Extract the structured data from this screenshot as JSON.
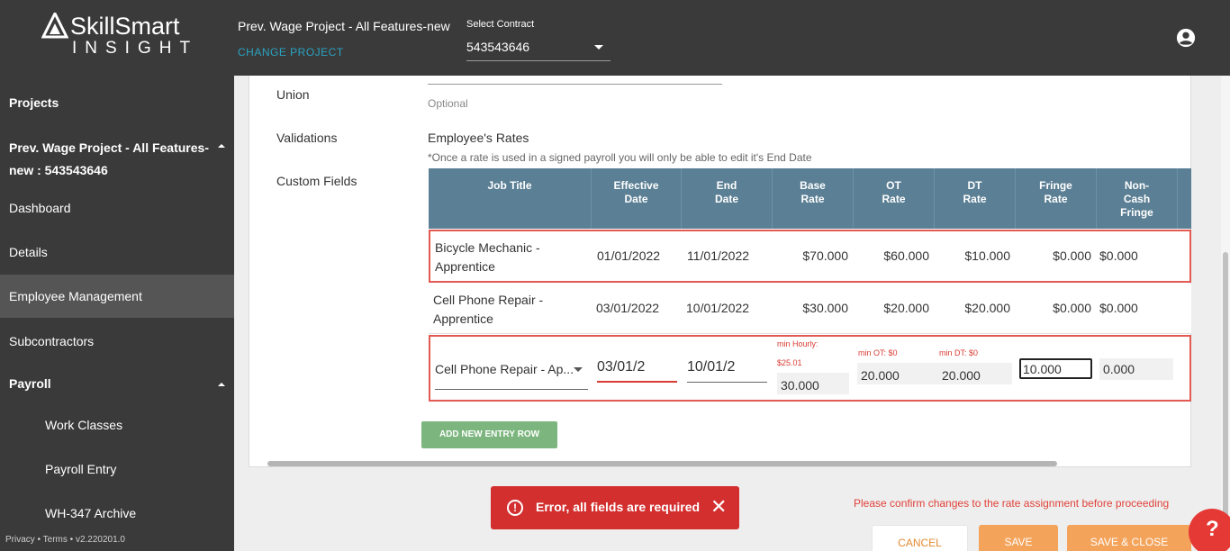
{
  "header": {
    "logo_main": "SkillSmart",
    "logo_sub": "INSIGHT",
    "project_title": "Prev. Wage Project - All Features-new",
    "change_project": "CHANGE PROJECT",
    "contract_label": "Select Contract",
    "contract_value": "543543646",
    "account_icon": "account-circle-icon"
  },
  "sidebar": {
    "projects": "Projects",
    "current_project_line1": "Prev. Wage Project - All Features-",
    "current_project_line2": "new : 543543646",
    "items": [
      "Dashboard",
      "Details",
      "Employee Management",
      "Subcontractors"
    ],
    "payroll": "Payroll",
    "payroll_items": [
      "Work Classes",
      "Payroll Entry",
      "WH-347 Archive"
    ],
    "footer": "Privacy • Terms • v2.220201.0",
    "active_item": "Employee Management"
  },
  "form": {
    "union_label": "Union",
    "union_hint": "Optional",
    "validations_label": "Validations",
    "custom_fields_label": "Custom Fields",
    "rates_title": "Employee's Rates",
    "rates_note": "*Once a rate is used in a signed payroll you will only be able to edit it's End Date"
  },
  "table": {
    "headers": {
      "job_title": "Job Title",
      "effective_date_1": "Effective",
      "effective_date_2": "Date",
      "end_date_1": "End",
      "end_date_2": "Date",
      "base_rate_1": "Base",
      "base_rate_2": "Rate",
      "ot_rate_1": "OT",
      "ot_rate_2": "Rate",
      "dt_rate_1": "DT",
      "dt_rate_2": "Rate",
      "fringe_rate_1": "Fringe",
      "fringe_rate_2": "Rate",
      "non_cash_1": "Non-",
      "non_cash_2": "Cash",
      "non_cash_3": "Fringe"
    },
    "rows": [
      {
        "job_line1": "Bicycle Mechanic -",
        "job_line2": "Apprentice",
        "effective": "01/01/2022",
        "end": "11/01/2022",
        "base": "$70.000",
        "ot": "$60.000",
        "dt": "$10.000",
        "fringe": "$0.000",
        "non_cash": "$0.000"
      },
      {
        "job_line1": "Cell Phone Repair -",
        "job_line2": "Apprentice",
        "effective": "03/01/2022",
        "end": "10/01/2022",
        "base": "$30.000",
        "ot": "$20.000",
        "dt": "$20.000",
        "fringe": "$0.000",
        "non_cash": "$0.000"
      }
    ],
    "edit_row": {
      "job": "Cell Phone Repair - Ap...",
      "effective": "03/01/2",
      "end": "10/01/2",
      "base_hint_1": "min Hourly:",
      "base_hint_2": "$25.01",
      "base": "30.000",
      "ot_hint": "min OT: $0",
      "ot": "20.000",
      "dt_hint": "min DT: $0",
      "dt": "20.000",
      "fringe": "10.000",
      "non_cash": "0.000"
    }
  },
  "actions": {
    "add_row": "ADD NEW ENTRY ROW",
    "confirm_msg": "Please confirm changes to the rate assignment before proceeding",
    "cancel": "CANCEL",
    "save": "SAVE",
    "save_close": "SAVE & CLOSE"
  },
  "toast": {
    "message": "Error, all fields are required",
    "close": "✕",
    "icon": "!"
  },
  "help": {
    "label": "?"
  },
  "colors": {
    "header_bg": "#3a3a3a",
    "table_header": "#5b7f94",
    "error": "#d32f2f",
    "accent_orange": "#f4a35a",
    "add_button": "#7cb67e",
    "link_teal": "#29a3c2"
  }
}
